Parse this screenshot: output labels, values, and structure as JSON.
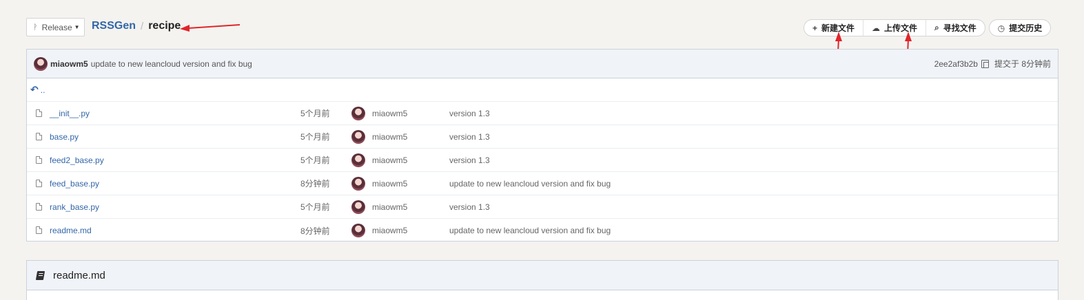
{
  "branch": {
    "label": "Release"
  },
  "breadcrumb": {
    "repo": "RSSGen",
    "separator": "/",
    "dir": "recipe"
  },
  "actions": {
    "new_file": "新建文件",
    "upload_file": "上传文件",
    "find_file": "寻找文件",
    "history": "提交历史"
  },
  "latest_commit": {
    "author": "miaowm5",
    "message": "update to new leancloud version and fix bug",
    "sha": "2ee2af3b2b",
    "time": "提交于 8分钟前"
  },
  "parent_dir": {
    "label": ".."
  },
  "files": [
    {
      "name": "__init__.py",
      "age": "5个月前",
      "committer": "miaowm5",
      "message": "version 1.3"
    },
    {
      "name": "base.py",
      "age": "5个月前",
      "committer": "miaowm5",
      "message": "version 1.3"
    },
    {
      "name": "feed2_base.py",
      "age": "5个月前",
      "committer": "miaowm5",
      "message": "version 1.3"
    },
    {
      "name": "feed_base.py",
      "age": "8分钟前",
      "committer": "miaowm5",
      "message": "update to new leancloud version and fix bug"
    },
    {
      "name": "rank_base.py",
      "age": "5个月前",
      "committer": "miaowm5",
      "message": "version 1.3"
    },
    {
      "name": "readme.md",
      "age": "8分钟前",
      "committer": "miaowm5",
      "message": "update to new leancloud version and fix bug"
    }
  ],
  "readme": {
    "title": "readme.md"
  },
  "colors": {
    "link": "#3366a8",
    "annotation_arrow": "#e0252b",
    "header_bg": "#f0f3f7"
  }
}
